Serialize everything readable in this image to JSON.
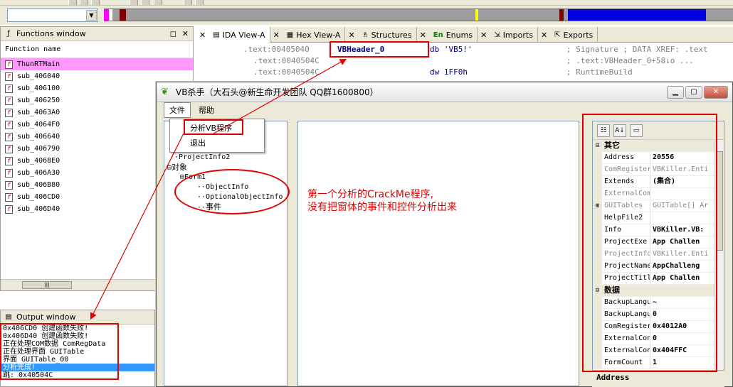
{
  "functions_window": {
    "title": "Functions window",
    "column": "Function name",
    "items": [
      "ThunRTMain",
      "sub_406040",
      "sub_406100",
      "sub_406250",
      "sub_4063A0",
      "sub_4064F0",
      "sub_406640",
      "sub_406790",
      "sub_4068E0",
      "sub_406A30",
      "sub_406B80",
      "sub_406CD0",
      "sub_406D40"
    ]
  },
  "tabs": [
    {
      "label": "IDA View-A",
      "icon": "ida-view-icon"
    },
    {
      "label": "Hex View-A",
      "icon": "hex-view-icon"
    },
    {
      "label": "Structures",
      "icon": "structures-icon"
    },
    {
      "label": "Enums",
      "icon": "enums-icon",
      "prefix": "En"
    },
    {
      "label": "Imports",
      "icon": "imports-icon"
    },
    {
      "label": "Exports",
      "icon": "exports-icon"
    }
  ],
  "ida_view": {
    "line1": {
      "addr": ".text:00405040",
      "label": "VBHeader_0",
      "instr": "db 'VB5!'",
      "comment": "; Signature ; DATA XREF: .text"
    },
    "line2": {
      "addr": ".text:0040504C",
      "comment": "; .text:VBHeader_0+58↓o ..."
    },
    "line3": {
      "addr": ".text:0040504C",
      "instr": "dw 1FF0h",
      "comment": "; RuntimeBuild"
    }
  },
  "output_window": {
    "title": "Output window",
    "lines": [
      "0x406CD0 创建函数失败!",
      "0x406D40 创建函数失败!",
      "正在处理COM数据 ComRegData",
      "正在处理界面 GUITable",
      "界面 GUITable_00",
      "分析完成!",
      "跳: 0x40504C"
    ]
  },
  "vb_window": {
    "title": "VB杀手（大石头@新生命开发团队 QQ群1600800）",
    "menu": {
      "file": "文件",
      "help": "帮助"
    },
    "dropdown": {
      "item1": "分析VB程序",
      "item2": "退出"
    },
    "tree": {
      "item_projectinfo2": "ProjectInfo2",
      "item_objects": "对象",
      "item_form1": "Form1",
      "item_objectinfo": "ObjectInfo",
      "item_optional": "OptionalObjectInfo",
      "item_events": "事件"
    },
    "annotation_line1": "第一个分析的CrackMe程序,",
    "annotation_line2": "没有把窗体的事件和控件分析出来",
    "props": {
      "cat_other": "其它",
      "cat_data": "数据",
      "rows_other": [
        {
          "name": "Address",
          "value": "20556",
          "gray": false
        },
        {
          "name": "ComRegister",
          "value": "VBKiller.Enti",
          "gray": true
        },
        {
          "name": "Extends",
          "value": "(集合)",
          "gray": false
        },
        {
          "name": "ExternalCom",
          "value": "",
          "gray": true
        },
        {
          "name": "GUITables",
          "value": "GUITable[] Ar",
          "gray": true,
          "expand": "⊞"
        },
        {
          "name": "HelpFile2",
          "value": "",
          "gray": false
        },
        {
          "name": "Info",
          "value": "VBKiller.VB:",
          "gray": false
        },
        {
          "name": "ProjectExe",
          "value": "App Challen",
          "gray": false
        },
        {
          "name": "ProjectInfo",
          "value": "VBKiller.Enti",
          "gray": true
        },
        {
          "name": "ProjectName",
          "value": "AppChalleng",
          "gray": false
        },
        {
          "name": "ProjectTitl",
          "value": "App Challen",
          "gray": false
        }
      ],
      "rows_data": [
        {
          "name": "BackupLangu",
          "value": "~",
          "gray": false
        },
        {
          "name": "BackupLangu",
          "value": "0",
          "gray": false
        },
        {
          "name": "ComRegister",
          "value": "0x4012A0",
          "gray": false
        },
        {
          "name": "ExternalCon",
          "value": "0",
          "gray": false
        },
        {
          "name": "ExternalCon",
          "value": "0x404FFC",
          "gray": false
        },
        {
          "name": "FormCount",
          "value": "1",
          "gray": false
        }
      ],
      "description": "Address"
    }
  },
  "colors": {
    "selection_pink": "#ff99ff",
    "annotation_red": "#e00000",
    "nav_blue": "#0000e0",
    "highlight_blue": "#3399ff"
  }
}
